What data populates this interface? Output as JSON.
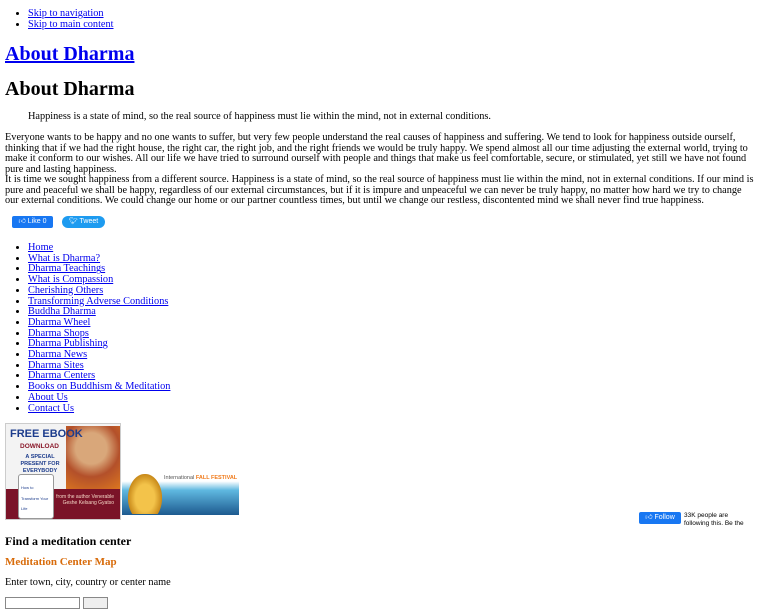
{
  "skip_links": [
    "Skip to navigation",
    "Skip to main content"
  ],
  "site_title": "About Dharma",
  "page_title": "About Dharma",
  "quote": "Happiness is a state of mind, so the real source of happiness must lie within the mind, not in external conditions.",
  "paragraphs": [
    "Everyone wants to be happy and no one wants to suffer, but very few people understand the real causes of happiness and suffering. We tend to look for happiness outside ourself, thinking that if we had the right house, the right car, the right job, and the right friends we would be truly happy. We spend almost all our time adjusting the external world, trying to make it conform to our wishes. All our life we have tried to surround ourself with people and things that make us feel comfortable, secure, or stimulated, yet still we have not found pure and lasting happiness.",
    "It is time we sought happiness from a different source. Happiness is a state of mind, so the real source of happiness must lie within the mind, not in external conditions. If our mind is pure and peaceful we shall be happy, regardless of our external circumstances, but if it is impure and unpeaceful we can never be truly happy, no matter how hard we try to change our external conditions. We could change our home or our partner countless times, but until we change our restless, discontented mind we shall never find true happiness."
  ],
  "social": {
    "like": "Like 0",
    "tweet": "Tweet",
    "follow": "Follow",
    "follow_text": "33K people are following this. Be the"
  },
  "nav": [
    "Home",
    "What is Dharma?",
    "Dharma Teachings",
    "What is Compassion",
    "Cherishing Others",
    "Transforming Adverse Conditions",
    "Buddha Dharma",
    "Dharma Wheel",
    "Dharma Shops",
    "Dharma Publishing",
    "Dharma News",
    "Dharma Sites",
    "Dharma Centers",
    "Books on Buddhism & Meditation",
    "About Us",
    "Contact Us"
  ],
  "ebook": {
    "line1": "FREE EBOOK",
    "line2": "DOWNLOAD",
    "line3": "A SPECIAL PRESENT FOR EVERYBODY",
    "book": "How to Transform Your Life",
    "author": "from the author Venerable Geshe Kelsang Gyatso"
  },
  "festival": {
    "pre": "International ",
    "highlight": "FALL FESTIVAL"
  },
  "finder": {
    "heading": "Find a meditation center",
    "map_link": "Meditation Center Map",
    "label": "Enter town, city, country or center name"
  },
  "colors": {
    "link": "#0000ee",
    "map_link": "#d86b0a",
    "facebook": "#1877f2",
    "twitter": "#1d9bf0"
  }
}
